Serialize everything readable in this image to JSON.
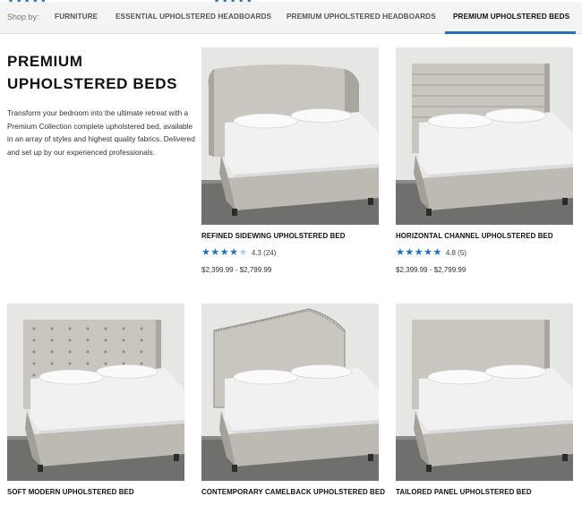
{
  "shopbar": {
    "label": "Shop by:",
    "tabs": [
      {
        "label": "FURNITURE"
      },
      {
        "label": "ESSENTIAL UPHOLSTERED HEADBOARDS"
      },
      {
        "label": "PREMIUM UPHOLSTERED HEADBOARDS"
      },
      {
        "label": "PREMIUM UPHOLSTERED BEDS",
        "active": true
      }
    ]
  },
  "intro": {
    "title_line1": "PREMIUM",
    "title_line2": "UPHOLSTERED BEDS",
    "text": "Transform your bedroom into the ultimate retreat with a Premium Collection complete upholstered bed, available in an array of styles and highest quality fabrics. Delivered and set up by our experienced professionals."
  },
  "products": [
    {
      "name": "REFINED SIDEWING UPHOLSTERED BED",
      "rating": 4.3,
      "rating_text": "4.3 (24)",
      "price": "$2,399.99 - $2,799.99",
      "headboard": "sidewing"
    },
    {
      "name": "HORIZONTAL CHANNEL UPHOLSTERED BED",
      "rating": 4.8,
      "rating_text": "4.8 (5)",
      "price": "$2,399.99 - $2,799.99",
      "headboard": "channel"
    },
    {
      "name": "SOFT MODERN UPHOLSTERED BED",
      "headboard": "tufted"
    },
    {
      "name": "CONTEMPORARY CAMELBACK UPHOLSTERED BED",
      "headboard": "camelback"
    },
    {
      "name": "TAILORED PANEL UPHOLSTERED BED",
      "headboard": "panel"
    }
  ],
  "colors": {
    "accent": "#2a6fb8",
    "star": "#1f6fc4",
    "fabric": "#c9c5bf",
    "mattress": "#f1f1f2",
    "backdrop": "#e6e6e4"
  }
}
